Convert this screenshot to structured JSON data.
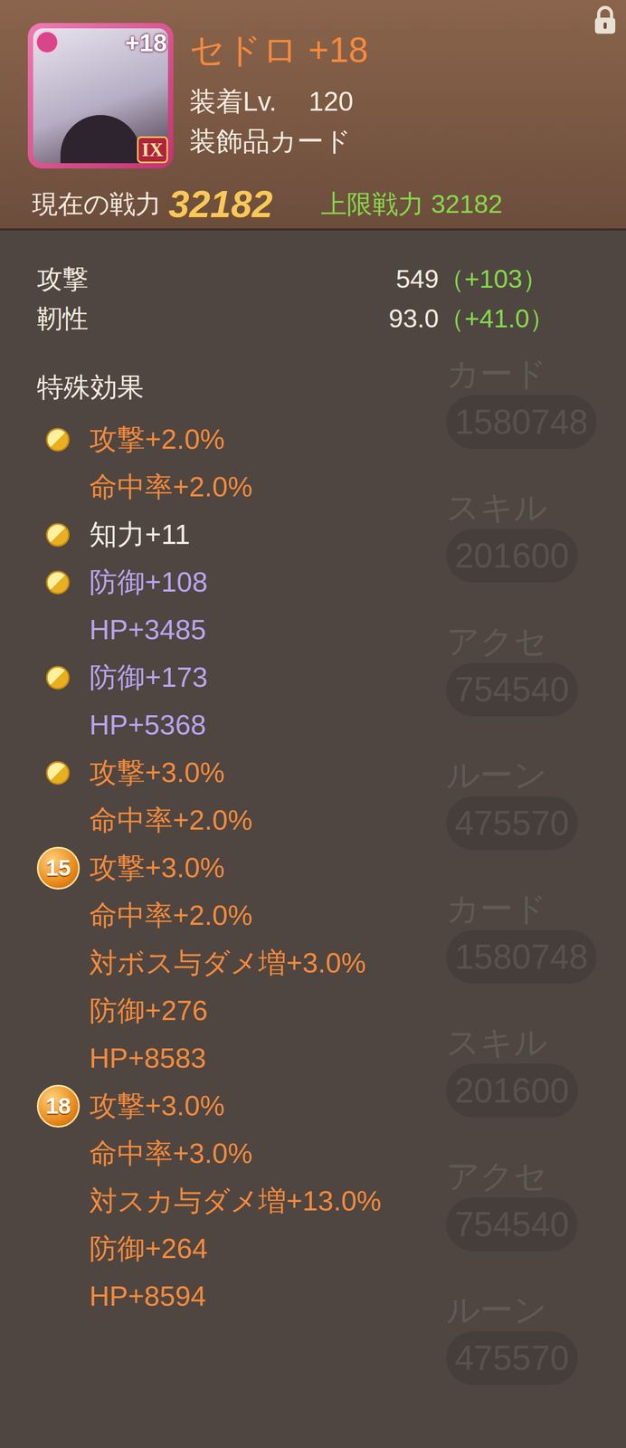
{
  "card": {
    "name": "セドロ +18",
    "badge": "+18",
    "rank": "IX",
    "equip_label": "装着Lv.",
    "equip_level": "120",
    "type": "装飾品カード",
    "power_label": "現在の戦力",
    "power": "32182",
    "max_power_label": "上限戦力",
    "max_power": "32182",
    "locked": true
  },
  "stats": [
    {
      "label": "攻撃",
      "value": "549",
      "bonus": "（+103）"
    },
    {
      "label": "靭性",
      "value": "93.0",
      "bonus": "（+41.0）"
    }
  ],
  "special": {
    "title": "特殊効果",
    "groups": [
      {
        "kind": "coin",
        "badge": "",
        "lines": [
          {
            "text": "攻撃+2.0%",
            "color": "#f58a3c"
          },
          {
            "text": "命中率+2.0%",
            "color": "#f58a3c"
          }
        ]
      },
      {
        "kind": "coin",
        "badge": "",
        "lines": [
          {
            "text": "知力+11",
            "color": "#f3ece4"
          }
        ]
      },
      {
        "kind": "coin",
        "badge": "",
        "lines": [
          {
            "text": "防御+108",
            "color": "#b9a4ef"
          },
          {
            "text": "HP+3485",
            "color": "#b9a4ef"
          }
        ]
      },
      {
        "kind": "coin",
        "badge": "",
        "lines": [
          {
            "text": "防御+173",
            "color": "#b9a4ef"
          },
          {
            "text": "HP+5368",
            "color": "#b9a4ef"
          }
        ]
      },
      {
        "kind": "coin",
        "badge": "",
        "lines": [
          {
            "text": "攻撃+3.0%",
            "color": "#f58a3c"
          },
          {
            "text": "命中率+2.0%",
            "color": "#f58a3c"
          }
        ]
      },
      {
        "kind": "tier",
        "badge": "15",
        "lines": [
          {
            "text": "攻撃+3.0%",
            "color": "#f58a3c"
          },
          {
            "text": "命中率+2.0%",
            "color": "#f58a3c"
          },
          {
            "text": "対ボス与ダメ増+3.0%",
            "color": "#f58a3c"
          },
          {
            "text": "防御+276",
            "color": "#f58a3c"
          },
          {
            "text": "HP+8583",
            "color": "#f58a3c"
          }
        ]
      },
      {
        "kind": "tier",
        "badge": "18",
        "lines": [
          {
            "text": "攻撃+3.0%",
            "color": "#f58a3c"
          },
          {
            "text": "命中率+3.0%",
            "color": "#f58a3c"
          },
          {
            "text": "対スカ与ダメ増+13.0%",
            "color": "#f58a3c"
          },
          {
            "text": "防御+264",
            "color": "#f58a3c"
          },
          {
            "text": "HP+8594",
            "color": "#f58a3c"
          }
        ]
      }
    ]
  },
  "background": [
    {
      "label": "カード",
      "value": "1580748"
    },
    {
      "label": "スキル",
      "value": "201600"
    },
    {
      "label": "アクセ",
      "value": "754540"
    },
    {
      "label": "ルーン",
      "value": "475570"
    },
    {
      "label": "カード",
      "value": "1580748"
    },
    {
      "label": "スキル",
      "value": "201600"
    },
    {
      "label": "アクセ",
      "value": "754540"
    },
    {
      "label": "ルーン",
      "value": "475570"
    }
  ]
}
